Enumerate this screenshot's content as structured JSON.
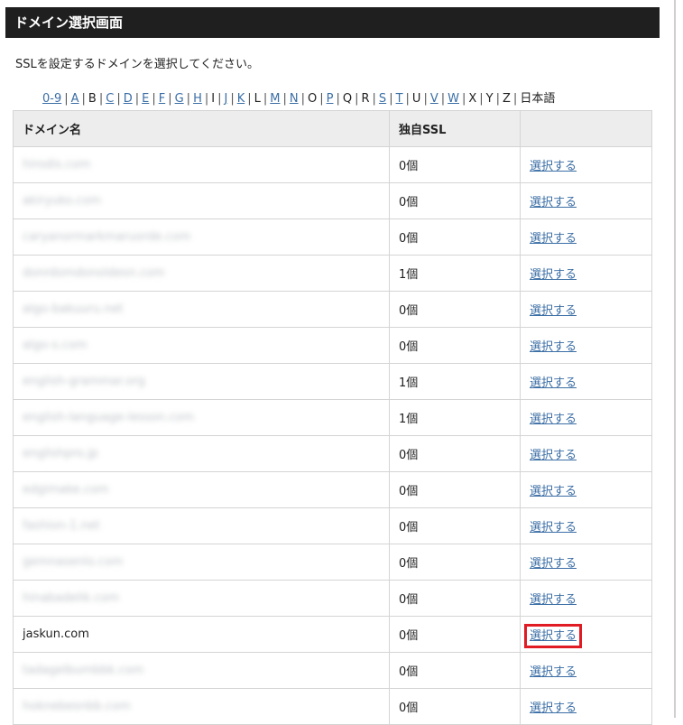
{
  "header": {
    "title": "ドメイン選択画面"
  },
  "intro": "SSLを設定するドメインを選択してください。",
  "alpha_nav": [
    {
      "label": "0-9",
      "link": true
    },
    {
      "label": "A",
      "link": true
    },
    {
      "label": "B",
      "link": false
    },
    {
      "label": "C",
      "link": true
    },
    {
      "label": "D",
      "link": true
    },
    {
      "label": "E",
      "link": true
    },
    {
      "label": "F",
      "link": true
    },
    {
      "label": "G",
      "link": true
    },
    {
      "label": "H",
      "link": true
    },
    {
      "label": "I",
      "link": false
    },
    {
      "label": "J",
      "link": true
    },
    {
      "label": "K",
      "link": true
    },
    {
      "label": "L",
      "link": false
    },
    {
      "label": "M",
      "link": true
    },
    {
      "label": "N",
      "link": true
    },
    {
      "label": "O",
      "link": false
    },
    {
      "label": "P",
      "link": true
    },
    {
      "label": "Q",
      "link": false
    },
    {
      "label": "R",
      "link": false
    },
    {
      "label": "S",
      "link": true
    },
    {
      "label": "T",
      "link": true
    },
    {
      "label": "U",
      "link": false
    },
    {
      "label": "V",
      "link": true
    },
    {
      "label": "W",
      "link": true
    },
    {
      "label": "X",
      "link": false
    },
    {
      "label": "Y",
      "link": false
    },
    {
      "label": "Z",
      "link": false
    },
    {
      "label": "日本語",
      "link": false
    }
  ],
  "table": {
    "headers": [
      "ドメイン名",
      "独自SSL",
      ""
    ],
    "rows": [
      {
        "domain": "hirodis.com",
        "blurred": true,
        "ssl": "0個",
        "action": "選択する",
        "highlight": false
      },
      {
        "domain": "akiryuko.com",
        "blurred": true,
        "ssl": "0個",
        "action": "選択する",
        "highlight": false
      },
      {
        "domain": "caryanormarkmaruorde.com",
        "blurred": true,
        "ssl": "0個",
        "action": "選択する",
        "highlight": false
      },
      {
        "domain": "donrdomdonoldesn.com",
        "blurred": true,
        "ssl": "1個",
        "action": "選択する",
        "highlight": false
      },
      {
        "domain": "algo-bakuuru.net",
        "blurred": true,
        "ssl": "0個",
        "action": "選択する",
        "highlight": false
      },
      {
        "domain": "algo-s.com",
        "blurred": true,
        "ssl": "0個",
        "action": "選択する",
        "highlight": false
      },
      {
        "domain": "english-grammar.org",
        "blurred": true,
        "ssl": "1個",
        "action": "選択する",
        "highlight": false
      },
      {
        "domain": "english-language-lesson.com",
        "blurred": true,
        "ssl": "1個",
        "action": "選択する",
        "highlight": false
      },
      {
        "domain": "englishpro.jp",
        "blurred": true,
        "ssl": "0個",
        "action": "選択する",
        "highlight": false
      },
      {
        "domain": "edgimake.com",
        "blurred": true,
        "ssl": "0個",
        "action": "選択する",
        "highlight": false
      },
      {
        "domain": "fashion-1.net",
        "blurred": true,
        "ssl": "0個",
        "action": "選択する",
        "highlight": false
      },
      {
        "domain": "gemnasenlo.com",
        "blurred": true,
        "ssl": "0個",
        "action": "選択する",
        "highlight": false
      },
      {
        "domain": "hinabadelik.com",
        "blurred": true,
        "ssl": "0個",
        "action": "選択する",
        "highlight": false
      },
      {
        "domain": "jaskun.com",
        "blurred": false,
        "ssl": "0個",
        "action": "選択する",
        "highlight": true
      },
      {
        "domain": "tadagelbumbbk.com",
        "blurred": true,
        "ssl": "0個",
        "action": "選択する",
        "highlight": false
      },
      {
        "domain": "hoknebesnbb.com",
        "blurred": true,
        "ssl": "0個",
        "action": "選択する",
        "highlight": false
      }
    ]
  }
}
